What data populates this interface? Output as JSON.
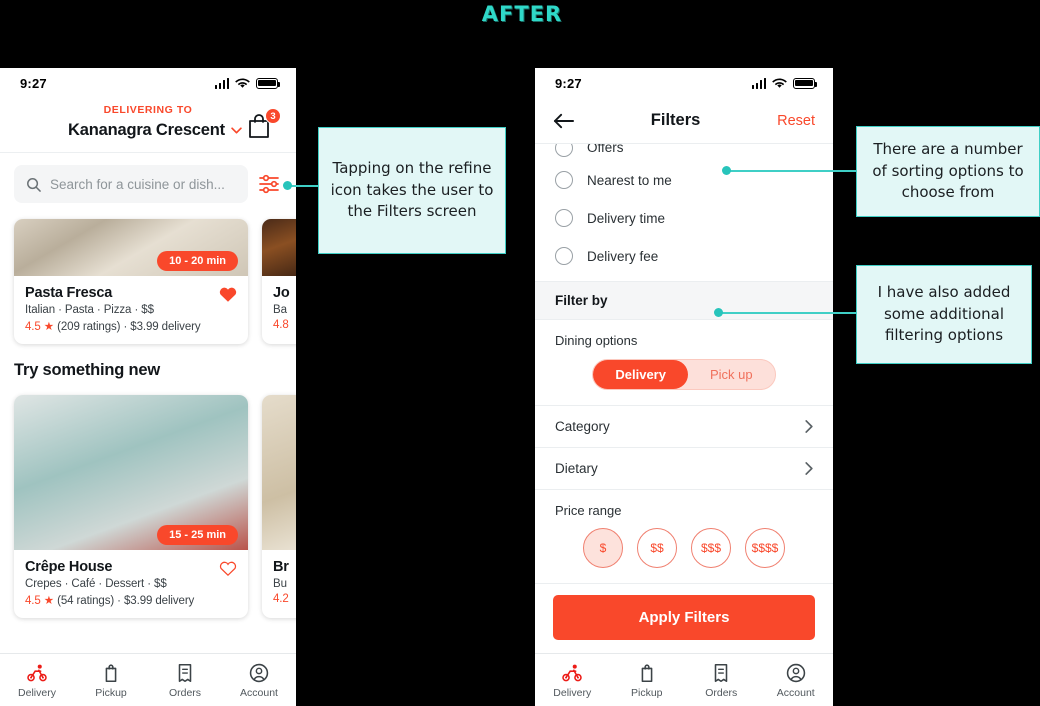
{
  "title": "AFTER",
  "phone_left": {
    "status": {
      "time": "9:27",
      "signal_icon": "signal-bars-icon",
      "wifi_icon": "wifi-icon",
      "battery_icon": "battery-icon"
    },
    "header": {
      "delivering_to_label": "DELIVERING TO",
      "address": "Kananagra Crescent",
      "chevron_icon": "chevron-down-icon",
      "cart_icon": "shopping-bag-icon",
      "cart_count": "3"
    },
    "search": {
      "placeholder": "Search for a cuisine or dish...",
      "search_icon": "search-icon",
      "refine_icon": "refine-sliders-icon"
    },
    "cards_top": [
      {
        "name": "Pasta Fresca",
        "time": "10 - 20 min",
        "tags": "Italian · Pasta · Pizza · $$",
        "rating": "4.5",
        "star": "★",
        "rating_meta": "(209 ratings) · $3.99 delivery",
        "favorite": true,
        "favorite_icon": "heart-filled-icon"
      },
      {
        "name": "Jo",
        "tags": "Ba",
        "rating": "4.8",
        "favorite": false,
        "partial": true
      }
    ],
    "section_title": "Try something new",
    "cards_bottom": [
      {
        "name": "Crêpe House",
        "time": "15 - 25 min",
        "tags": "Crepes · Café · Dessert · $$",
        "rating": "4.5",
        "star": "★",
        "rating_meta": "(54 ratings) · $3.99 delivery",
        "favorite": false,
        "favorite_icon": "heart-outline-icon"
      },
      {
        "name": "Br",
        "tags": "Bu",
        "rating": "4.2",
        "favorite": false,
        "partial": true
      }
    ],
    "bottom_nav": [
      {
        "label": "Delivery",
        "icon": "bicycle-delivery-icon",
        "active": true
      },
      {
        "label": "Pickup",
        "icon": "bag-pickup-icon",
        "active": false
      },
      {
        "label": "Orders",
        "icon": "receipt-orders-icon",
        "active": false
      },
      {
        "label": "Account",
        "icon": "person-account-icon",
        "active": false
      }
    ]
  },
  "phone_right": {
    "status": {
      "time": "9:27"
    },
    "header": {
      "back_icon": "back-arrow-icon",
      "title": "Filters",
      "reset_label": "Reset"
    },
    "sort_options": [
      {
        "label": "Offers",
        "selected": false
      },
      {
        "label": "Nearest to me",
        "selected": false
      },
      {
        "label": "Delivery time",
        "selected": false
      },
      {
        "label": "Delivery fee",
        "selected": false
      }
    ],
    "filter_by_label": "Filter by",
    "dining": {
      "label": "Dining options",
      "options": [
        {
          "label": "Delivery",
          "selected": true
        },
        {
          "label": "Pick up",
          "selected": false
        }
      ]
    },
    "rows": [
      {
        "label": "Category",
        "chevron_icon": "chevron-right-icon"
      },
      {
        "label": "Dietary",
        "chevron_icon": "chevron-right-icon"
      }
    ],
    "price": {
      "label": "Price range",
      "options": [
        {
          "label": "$",
          "selected": true
        },
        {
          "label": "$$",
          "selected": false
        },
        {
          "label": "$$$",
          "selected": false
        },
        {
          "label": "$$$$",
          "selected": false
        }
      ]
    },
    "apply_label": "Apply Filters",
    "bottom_nav": [
      {
        "label": "Delivery",
        "icon": "bicycle-delivery-icon",
        "active": true
      },
      {
        "label": "Pickup",
        "icon": "bag-pickup-icon",
        "active": false
      },
      {
        "label": "Orders",
        "icon": "receipt-orders-icon",
        "active": false
      },
      {
        "label": "Account",
        "icon": "person-account-icon",
        "active": false
      }
    ]
  },
  "callouts": {
    "refine": "Tapping on the refine icon takes the user to the Filters screen",
    "sorting": "There are a number of sorting options to choose from",
    "filtering": "I have also added some additional filtering options"
  },
  "colors": {
    "accent": "#f9482b",
    "callout_bg": "#e2f7f6",
    "callout_border": "#3fcfc6",
    "connector": "#27c4bb"
  }
}
